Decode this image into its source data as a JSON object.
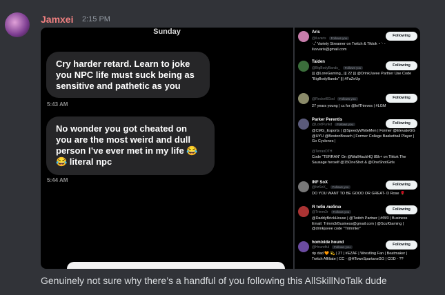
{
  "message": {
    "username": "Jamxei",
    "timestamp": "2:15 PM",
    "caption": "Genuinely not sure why there’s a handful of you following this AllSkillNoTalk dude"
  },
  "chat": {
    "day": "Sunday",
    "bubbles": [
      {
        "text": "Cry harder retard. Learn to joke you NPC life must suck being as sensitive and pathetic as you",
        "time": "5:43 AM"
      },
      {
        "text": "No wonder you got cheated on you are the most weird and dull person I’ve ever met in my life 😂 😂 literal npc",
        "time": "5:44 AM"
      }
    ]
  },
  "following": {
    "button_label": "Following",
    "follows_you_label": "Follows you",
    "accounts": [
      {
        "name": "Aris",
        "handle": "@iluvaris",
        "follows_you": true,
        "bio": "‧₊˚ Variety Streamer on Twitch & Tiktok ⋆˙‧ - iluvvaris@gmail.com",
        "color": "#c77dab"
      },
      {
        "name": "Taiden",
        "handle": "@BigBodyBands_",
        "follows_you": true,
        "bio": "||| @LoreGaming_ ||| 22 ||| @DrinkJuvee Partner Use Code \"BigBodyBands\" ||| #FaZeUp",
        "color": "#3b6e3b"
      },
      {
        "name": "",
        "handle": "@Rocket6God",
        "follows_you": true,
        "bio": "27 years young | cc for @InfThieves | #LGM",
        "color": "#8b8b6a"
      },
      {
        "name": "Parker Perentis",
        "handle": "@LordPunkd",
        "follows_you": true,
        "bio": "@CMG_Esports | @SpeedyWhiteMen | Former @ElevateGG @UYU @BostonBreach | Former College Basketball Player | Go Cyclones |",
        "color": "#5a5a7a"
      },
      {
        "name": "",
        "handle": "@TerranDTH",
        "follows_you": false,
        "bio": "Code \"TERRAN\" On @WallHackHQ 85k+ on Tiktok The Sausage herself @15OneShot & @OneShotGirls",
        "color": "#444"
      },
      {
        "name": "INF SoX",
        "handle": "@ItzSoX_",
        "follows_you": true,
        "bio": "DO YOU WANT TO BE GOOD OR GREAT- D Rose 🌹",
        "color": "#777"
      },
      {
        "name": "Я тебя люблю",
        "handle": "@Trimm3r",
        "follows_you": true,
        "bio": "@DaddyBrickHouse | @Twitch Partner | #f3f3 | Business Email: Trimm3rBusiness@gmail.com | @ScufGaming | @drinkjuvee code \"Trimmler\"",
        "color": "#a33"
      },
      {
        "name": "homixide hound",
        "handle": "@Houndful",
        "follows_you": true,
        "bio": "rip dad 🧡 💫 | 27 | #EZAF | Wrestling Fan | Beatmaker | Twitch Affiliate | CC - @HTownSpartansGG | COD - ??",
        "color": "#6b4ba0"
      }
    ]
  }
}
